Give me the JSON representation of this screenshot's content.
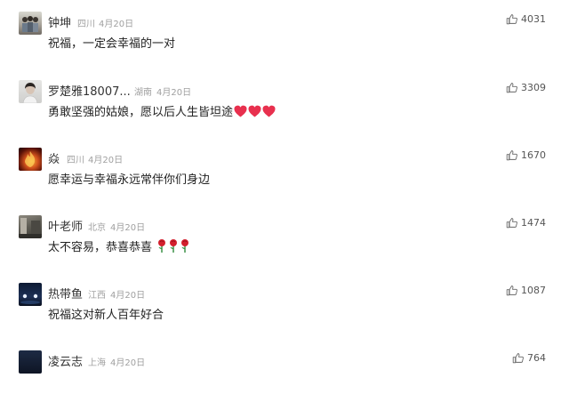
{
  "comments": [
    {
      "name": "钟坤",
      "location": "四川",
      "date": "4月20日",
      "text": "祝福，一定会幸福的一对",
      "likes": "4031",
      "avatar": "group-photo"
    },
    {
      "name": "罗楚雅18007...",
      "location": "湖南",
      "date": "4月20日",
      "text": "勇敢坚强的姑娘，愿以后人生皆坦途",
      "likes": "3309",
      "avatar": "portrait-photo"
    },
    {
      "name": "焱",
      "location": "四川",
      "date": "4月20日",
      "text": "愿幸运与幸福永远常伴你们身边",
      "likes": "1670",
      "avatar": "fire-photo"
    },
    {
      "name": "叶老师",
      "location": "北京",
      "date": "4月20日",
      "text": "太不容易，恭喜恭喜",
      "likes": "1474",
      "avatar": "street-photo"
    },
    {
      "name": "热带鱼",
      "location": "江西",
      "date": "4月20日",
      "text": "祝福这对新人百年好合",
      "likes": "1087",
      "avatar": "night-photo"
    },
    {
      "name": "凌云志",
      "location": "上海",
      "date": "4月20日",
      "text": "",
      "likes": "764",
      "avatar": "dark-photo"
    }
  ],
  "icons": {
    "like": "thumbs-up-icon",
    "heart": "red-heart-icon",
    "rose": "rose-icon"
  },
  "colors": {
    "heart": "#e8304e",
    "rose": "#d3202e",
    "text": "#222222",
    "meta": "#a0a0a0"
  }
}
